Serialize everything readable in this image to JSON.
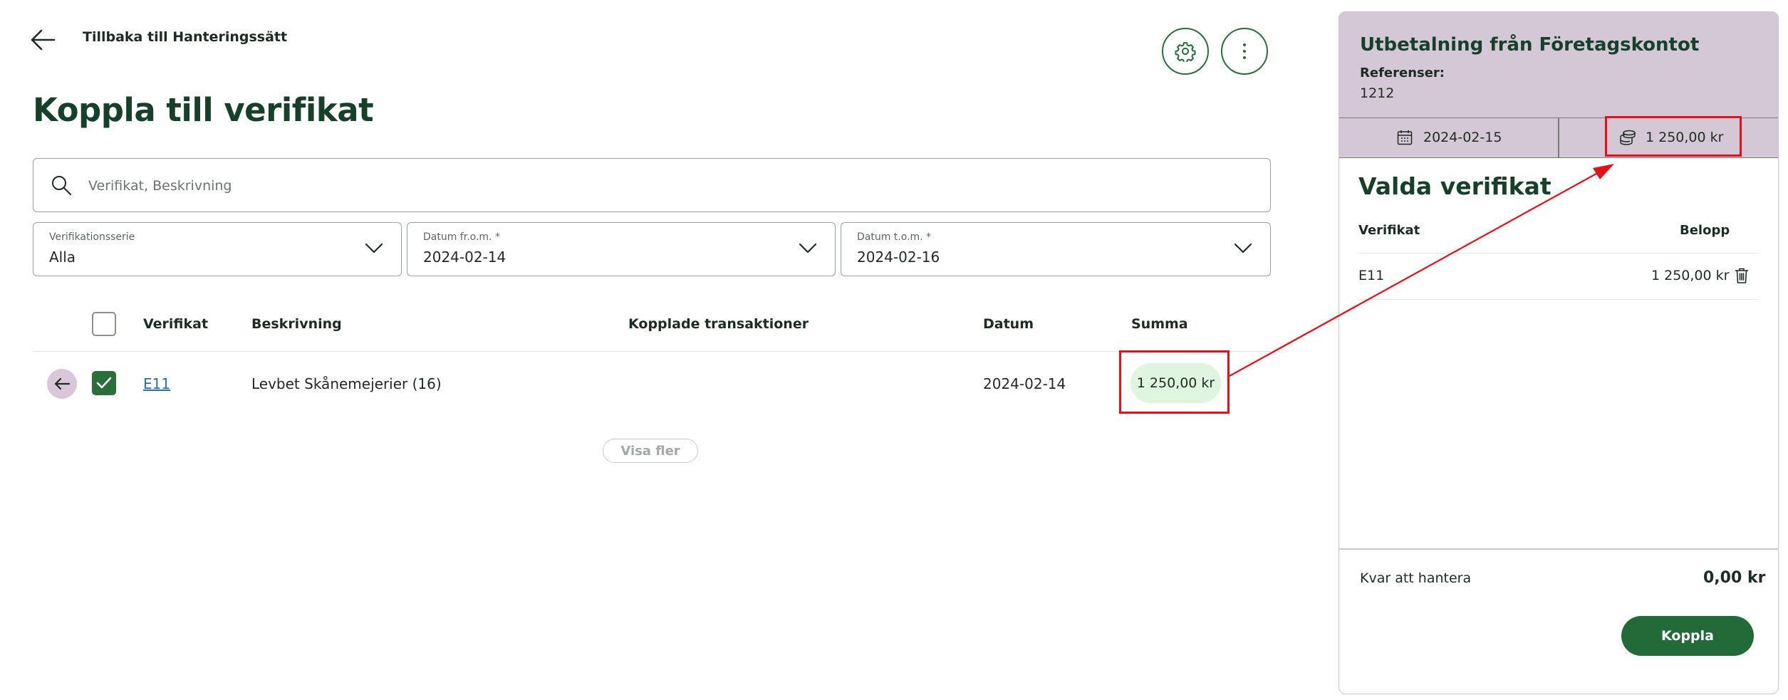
{
  "header": {
    "back_label": "Tillbaka till Hanteringssätt",
    "title": "Koppla till verifikat"
  },
  "search": {
    "placeholder": "Verifikat, Beskrivning",
    "icon": "search-icon"
  },
  "filters": [
    {
      "label": "Verifikationsserie",
      "value": "Alla"
    },
    {
      "label": "Datum fr.o.m. *",
      "value": "2024-02-14"
    },
    {
      "label": "Datum t.o.m. *",
      "value": "2024-02-16"
    }
  ],
  "table": {
    "columns": [
      "Verifikat",
      "Beskrivning",
      "Kopplade transaktioner",
      "Datum",
      "Summa"
    ],
    "rows": [
      {
        "verifikat": "E11",
        "beskrivning": "Levbet Skånemejerier (16)",
        "kopplade": "",
        "datum": "2024-02-14",
        "summa": "1 250,00 kr",
        "selected": true
      }
    ],
    "show_more_label": "Visa fler"
  },
  "panel": {
    "title": "Utbetalning från Företagskontot",
    "references_label": "Referenser:",
    "references_value": "1212",
    "date": "2024-02-15",
    "amount": "1 250,00 kr",
    "selected_title": "Valda verifikat",
    "columns": [
      "Verifikat",
      "Belopp"
    ],
    "rows": [
      {
        "verifikat": "E11",
        "belopp": "1 250,00 kr"
      }
    ],
    "remaining_label": "Kvar att hantera",
    "remaining_value": "0,00 kr",
    "submit_label": "Koppla"
  },
  "colors": {
    "primary_green": "#226b38",
    "panel_header": "#d5c8d6",
    "sum_highlight": "#dff5df",
    "annotation_red": "#e3101a"
  }
}
